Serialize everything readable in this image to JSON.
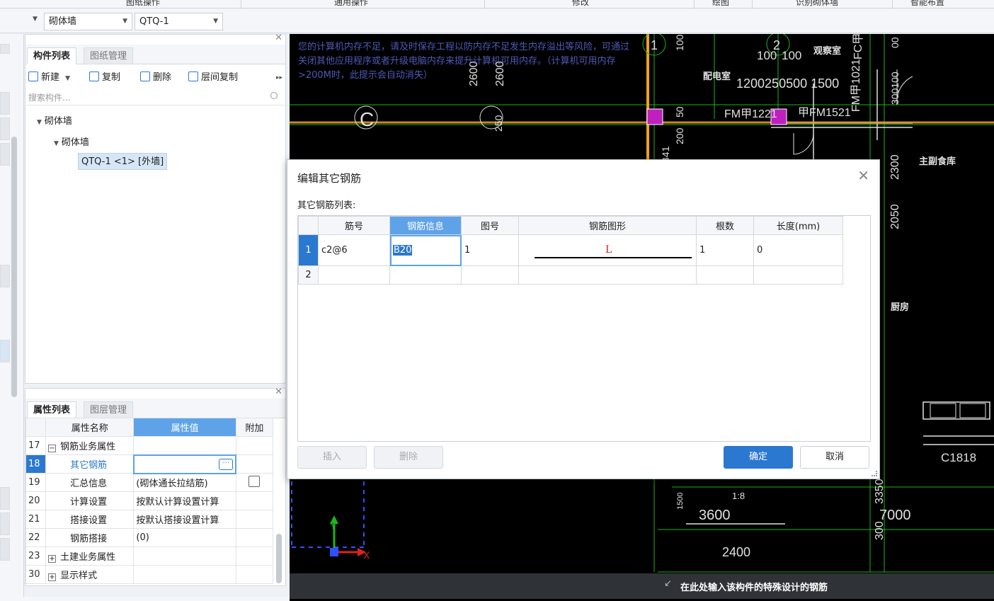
{
  "ribbon": {
    "labels": [
      "图纸操作",
      "通用操作",
      "修改",
      "绘图",
      "识别砌体墙",
      "智能布置"
    ]
  },
  "selectors": {
    "category": "砌体墙",
    "component": "QTQ-1"
  },
  "component_panel": {
    "tabs": [
      "构件列表",
      "图纸管理"
    ],
    "toolbar": {
      "new": "新建",
      "copy": "复制",
      "delete": "删除",
      "floor_copy": "层间复制"
    },
    "search_placeholder": "搜索构件...",
    "tree": {
      "root": "砌体墙",
      "child": "砌体墙",
      "leaf": "QTQ-1 <1> [外墙]"
    }
  },
  "property_panel": {
    "tabs": [
      "属性列表",
      "图层管理"
    ],
    "headers": {
      "name": "属性名称",
      "value": "属性值",
      "extra": "附加"
    },
    "rows": [
      {
        "num": "17",
        "name": "钢筋业务属性",
        "value": ""
      },
      {
        "num": "18",
        "name": "其它钢筋",
        "value": ""
      },
      {
        "num": "19",
        "name": "汇总信息",
        "value": "(砌体通长拉结筋)"
      },
      {
        "num": "20",
        "name": "计算设置",
        "value": "按默认计算设置计算"
      },
      {
        "num": "21",
        "name": "搭接设置",
        "value": "按默认搭接设置计算"
      },
      {
        "num": "22",
        "name": "钢筋搭接",
        "value": "(0)"
      },
      {
        "num": "23",
        "name": "土建业务属性",
        "value": ""
      },
      {
        "num": "30",
        "name": "显示样式",
        "value": ""
      }
    ]
  },
  "cad": {
    "warning": "您的计算机内存不足，请及时保存工程以防内存不足发生内存溢出等风险，可通过关闭其他应用程序或者升级电脑内存来提升计算机可用内存。（计算机可用内存>200M时，此提示会自动消失）",
    "status_text": "在此处输入该构件的特殊设计的钢筋",
    "labels": {
      "dim_100a": "100",
      "dim_100b": "100",
      "room_guan": "观察室",
      "room_pei": "配电室",
      "dim_row": "1200250500 1500",
      "door_fm1221": "FM甲1221",
      "door_fm1521": "甲FM1521",
      "room_zhufu": "主副食库",
      "room_chu": "厨房",
      "win_c1818": "C1818",
      "dim_3600": "3600",
      "dim_7000": "7000",
      "dim_2400": "2400",
      "ratio": "1:8",
      "axis_c": "C",
      "axis_2": "2",
      "axis_1": "1",
      "axis_y": "Y",
      "axis_x": "X",
      "v_fm1021": "FM甲1021",
      "v_fc": "FC甲",
      "v_2300": "2300",
      "v_2050": "2050",
      "v_2600a": "2600",
      "v_2600b": "2600",
      "v_3350": "3350",
      "v_300": "300",
      "v_1500": "1500",
      "v_250": "250",
      "v_341": "341",
      "v_200": "200",
      "v_50": "50",
      "v_100": "100",
      "v_300100": "300100",
      "v_00": "00"
    }
  },
  "dialog": {
    "title": "编辑其它钢筋",
    "subtitle": "其它钢筋列表:",
    "headers": [
      "筋号",
      "钢筋信息",
      "图号",
      "钢筋图形",
      "根数",
      "长度(mm)"
    ],
    "rows": [
      {
        "num": "1",
        "bar_no": "c2@6",
        "info": "B20",
        "fig": "1",
        "shape_label": "L",
        "count": "1",
        "length": "0"
      },
      {
        "num": "2",
        "bar_no": "",
        "info": "",
        "fig": "",
        "shape_label": "",
        "count": "",
        "length": ""
      }
    ],
    "buttons": {
      "insert": "插入",
      "delete": "删除",
      "ok": "确定",
      "cancel": "取消"
    },
    "colors": {
      "accent": "#2b78d0",
      "header_highlight": "#5ea3e8"
    }
  }
}
